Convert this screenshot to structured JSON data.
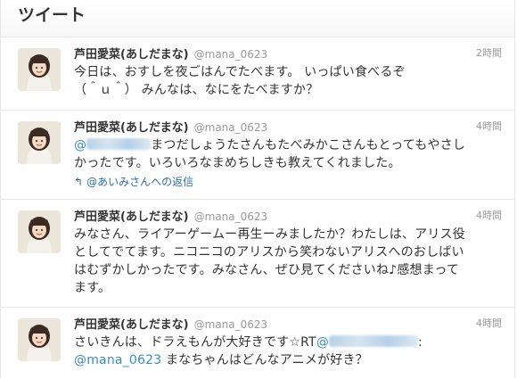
{
  "header": {
    "title": "ツイート"
  },
  "tweets": [
    {
      "name": "芦田愛菜(あしだまな)",
      "handle": "@mana_0623",
      "time": "2時間",
      "text": "今日は、おすしを夜ごはんでたべます。 いっぱい食べるぞ\n（＾ｕ＾） みんなは、なにをたべますか？"
    },
    {
      "name": "芦田愛菜(あしだまな)",
      "handle": "@mana_0623",
      "time": "4時間",
      "mention_prefix": "@",
      "text_after_mention": "まつだしょうたさんもたべみかこさんもとってもやさし",
      "text_line2": "かったです。いろいろなまめちしきも教えてくれました。",
      "reply_label": "@あいみさんへの返信"
    },
    {
      "name": "芦田愛菜(あしだまな)",
      "handle": "@mana_0623",
      "time": "4時間",
      "text": "みなさん、ライアーゲームー再生ーみましたか？わたしは、アリス役\nとしてでてます。ニコニコのアリスから笑わないアリスへのおしばい\nはむずかしかったです。みなさん、ぜひ見てくださいね♪感想まって\nます。"
    },
    {
      "name": "芦田愛菜(あしだまな)",
      "handle": "@mana_0623",
      "time": "4時間",
      "text_before": "さいきんは、ドラえもんが大好きです☆RT",
      "mention_prefix": "@",
      "after_blur": ":",
      "mention2": "@mana_0623",
      "text_line2": " まなちゃんはどんなアニメが好き？"
    }
  ],
  "icons": {
    "reply": "reply-arrow-icon",
    "avatar": "avatar-photo"
  }
}
